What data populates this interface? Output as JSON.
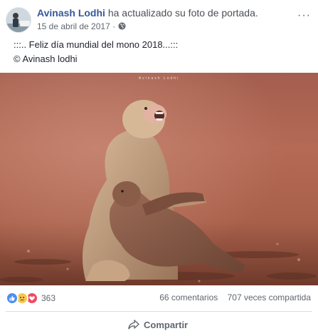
{
  "post": {
    "author": "Avinash Lodhi",
    "action": "ha actualizado su foto de portada.",
    "date": "15 de abril de 2017",
    "date_separator": "·",
    "privacy_icon": "globe-icon",
    "menu_icon": "more-options-icon",
    "more_label": "···"
  },
  "caption": {
    "line1": ":::.. Feliz día mundial del mono 2018...:::",
    "line2": "© Avinash lodhi"
  },
  "photo": {
    "watermark": "Avinash Lodhi",
    "subject": "monkey-photo"
  },
  "stats": {
    "reaction_icons": [
      "like-icon",
      "sad-icon",
      "love-icon"
    ],
    "reaction_count": "363",
    "comments": "66 comentarios",
    "shares": "707 veces compartida"
  },
  "actions": {
    "share_label": "Compartir",
    "share_icon": "share-arrow-icon"
  },
  "colors": {
    "author": "#365899",
    "like": "#4a8ff7",
    "sad": "#f7c64a",
    "love": "#ef4a63"
  }
}
